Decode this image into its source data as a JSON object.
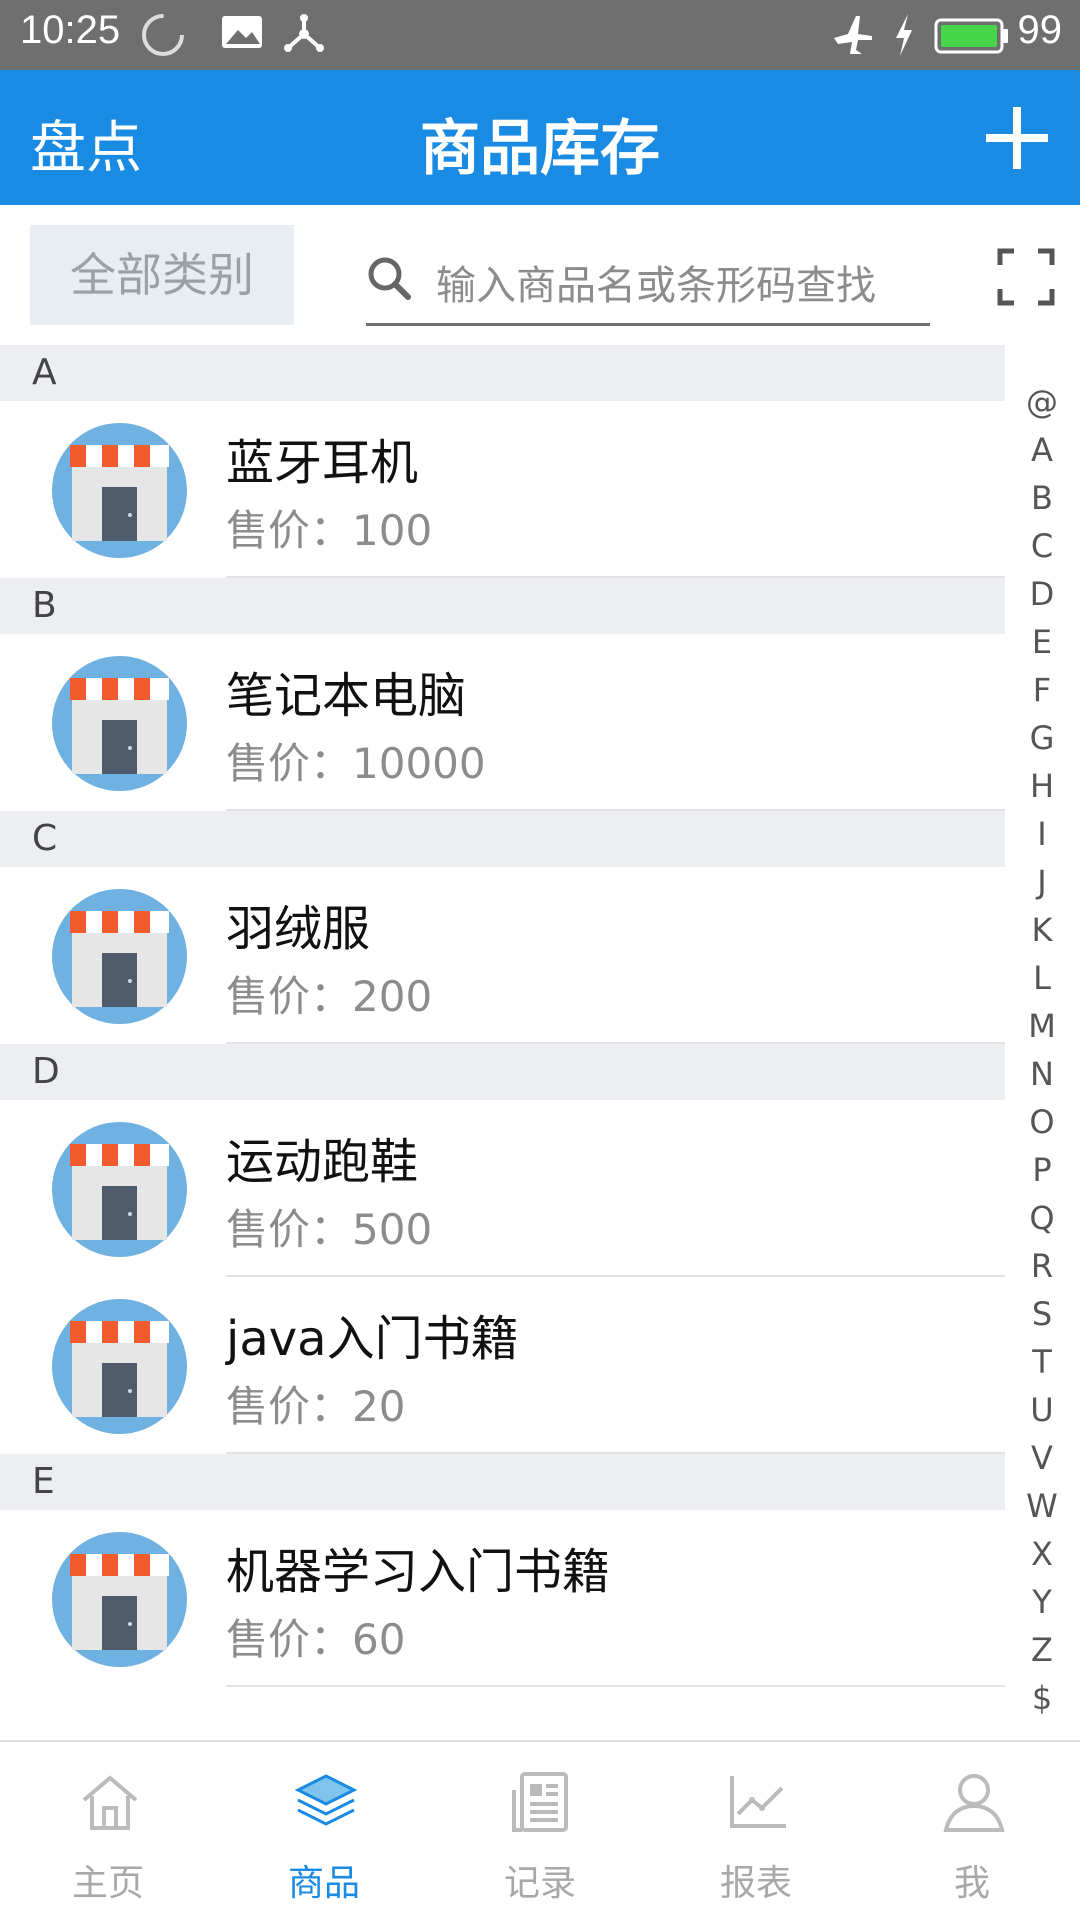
{
  "status_bar": {
    "time": "10:25",
    "battery": "99"
  },
  "app_bar": {
    "left_action": "盘点",
    "title": "商品库存",
    "add_icon": "plus-icon"
  },
  "filter": {
    "category": "全部类别",
    "search_placeholder": "输入商品名或条形码查找",
    "scan_icon": "scan-frame-icon"
  },
  "sections": [
    {
      "letter": "A",
      "items": [
        {
          "name": "蓝牙耳机",
          "price_label": "售价：",
          "price": "100"
        }
      ]
    },
    {
      "letter": "B",
      "items": [
        {
          "name": "笔记本电脑",
          "price_label": "售价：",
          "price": "10000"
        }
      ]
    },
    {
      "letter": "C",
      "items": [
        {
          "name": "羽绒服",
          "price_label": "售价：",
          "price": "200"
        }
      ]
    },
    {
      "letter": "D",
      "items": [
        {
          "name": "运动跑鞋",
          "price_label": "售价：",
          "price": "500"
        },
        {
          "name": "java入门书籍",
          "price_label": "售价：",
          "price": "20"
        }
      ]
    },
    {
      "letter": "E",
      "items": [
        {
          "name": "机器学习入门书籍",
          "price_label": "售价：",
          "price": "60"
        }
      ]
    }
  ],
  "alphabet": [
    "@",
    "A",
    "B",
    "C",
    "D",
    "E",
    "F",
    "G",
    "H",
    "I",
    "J",
    "K",
    "L",
    "M",
    "N",
    "O",
    "P",
    "Q",
    "R",
    "S",
    "T",
    "U",
    "V",
    "W",
    "X",
    "Y",
    "Z",
    "$"
  ],
  "bottom_nav": [
    {
      "label": "主页",
      "icon": "home-icon",
      "active": false
    },
    {
      "label": "商品",
      "icon": "layers-icon",
      "active": true
    },
    {
      "label": "记录",
      "icon": "document-icon",
      "active": false
    },
    {
      "label": "报表",
      "icon": "chart-icon",
      "active": false
    },
    {
      "label": "我",
      "icon": "user-icon",
      "active": false
    }
  ],
  "colors": {
    "primary": "#1a8be2",
    "section_bg": "#eceef2",
    "category_bg": "#e8edf3"
  }
}
